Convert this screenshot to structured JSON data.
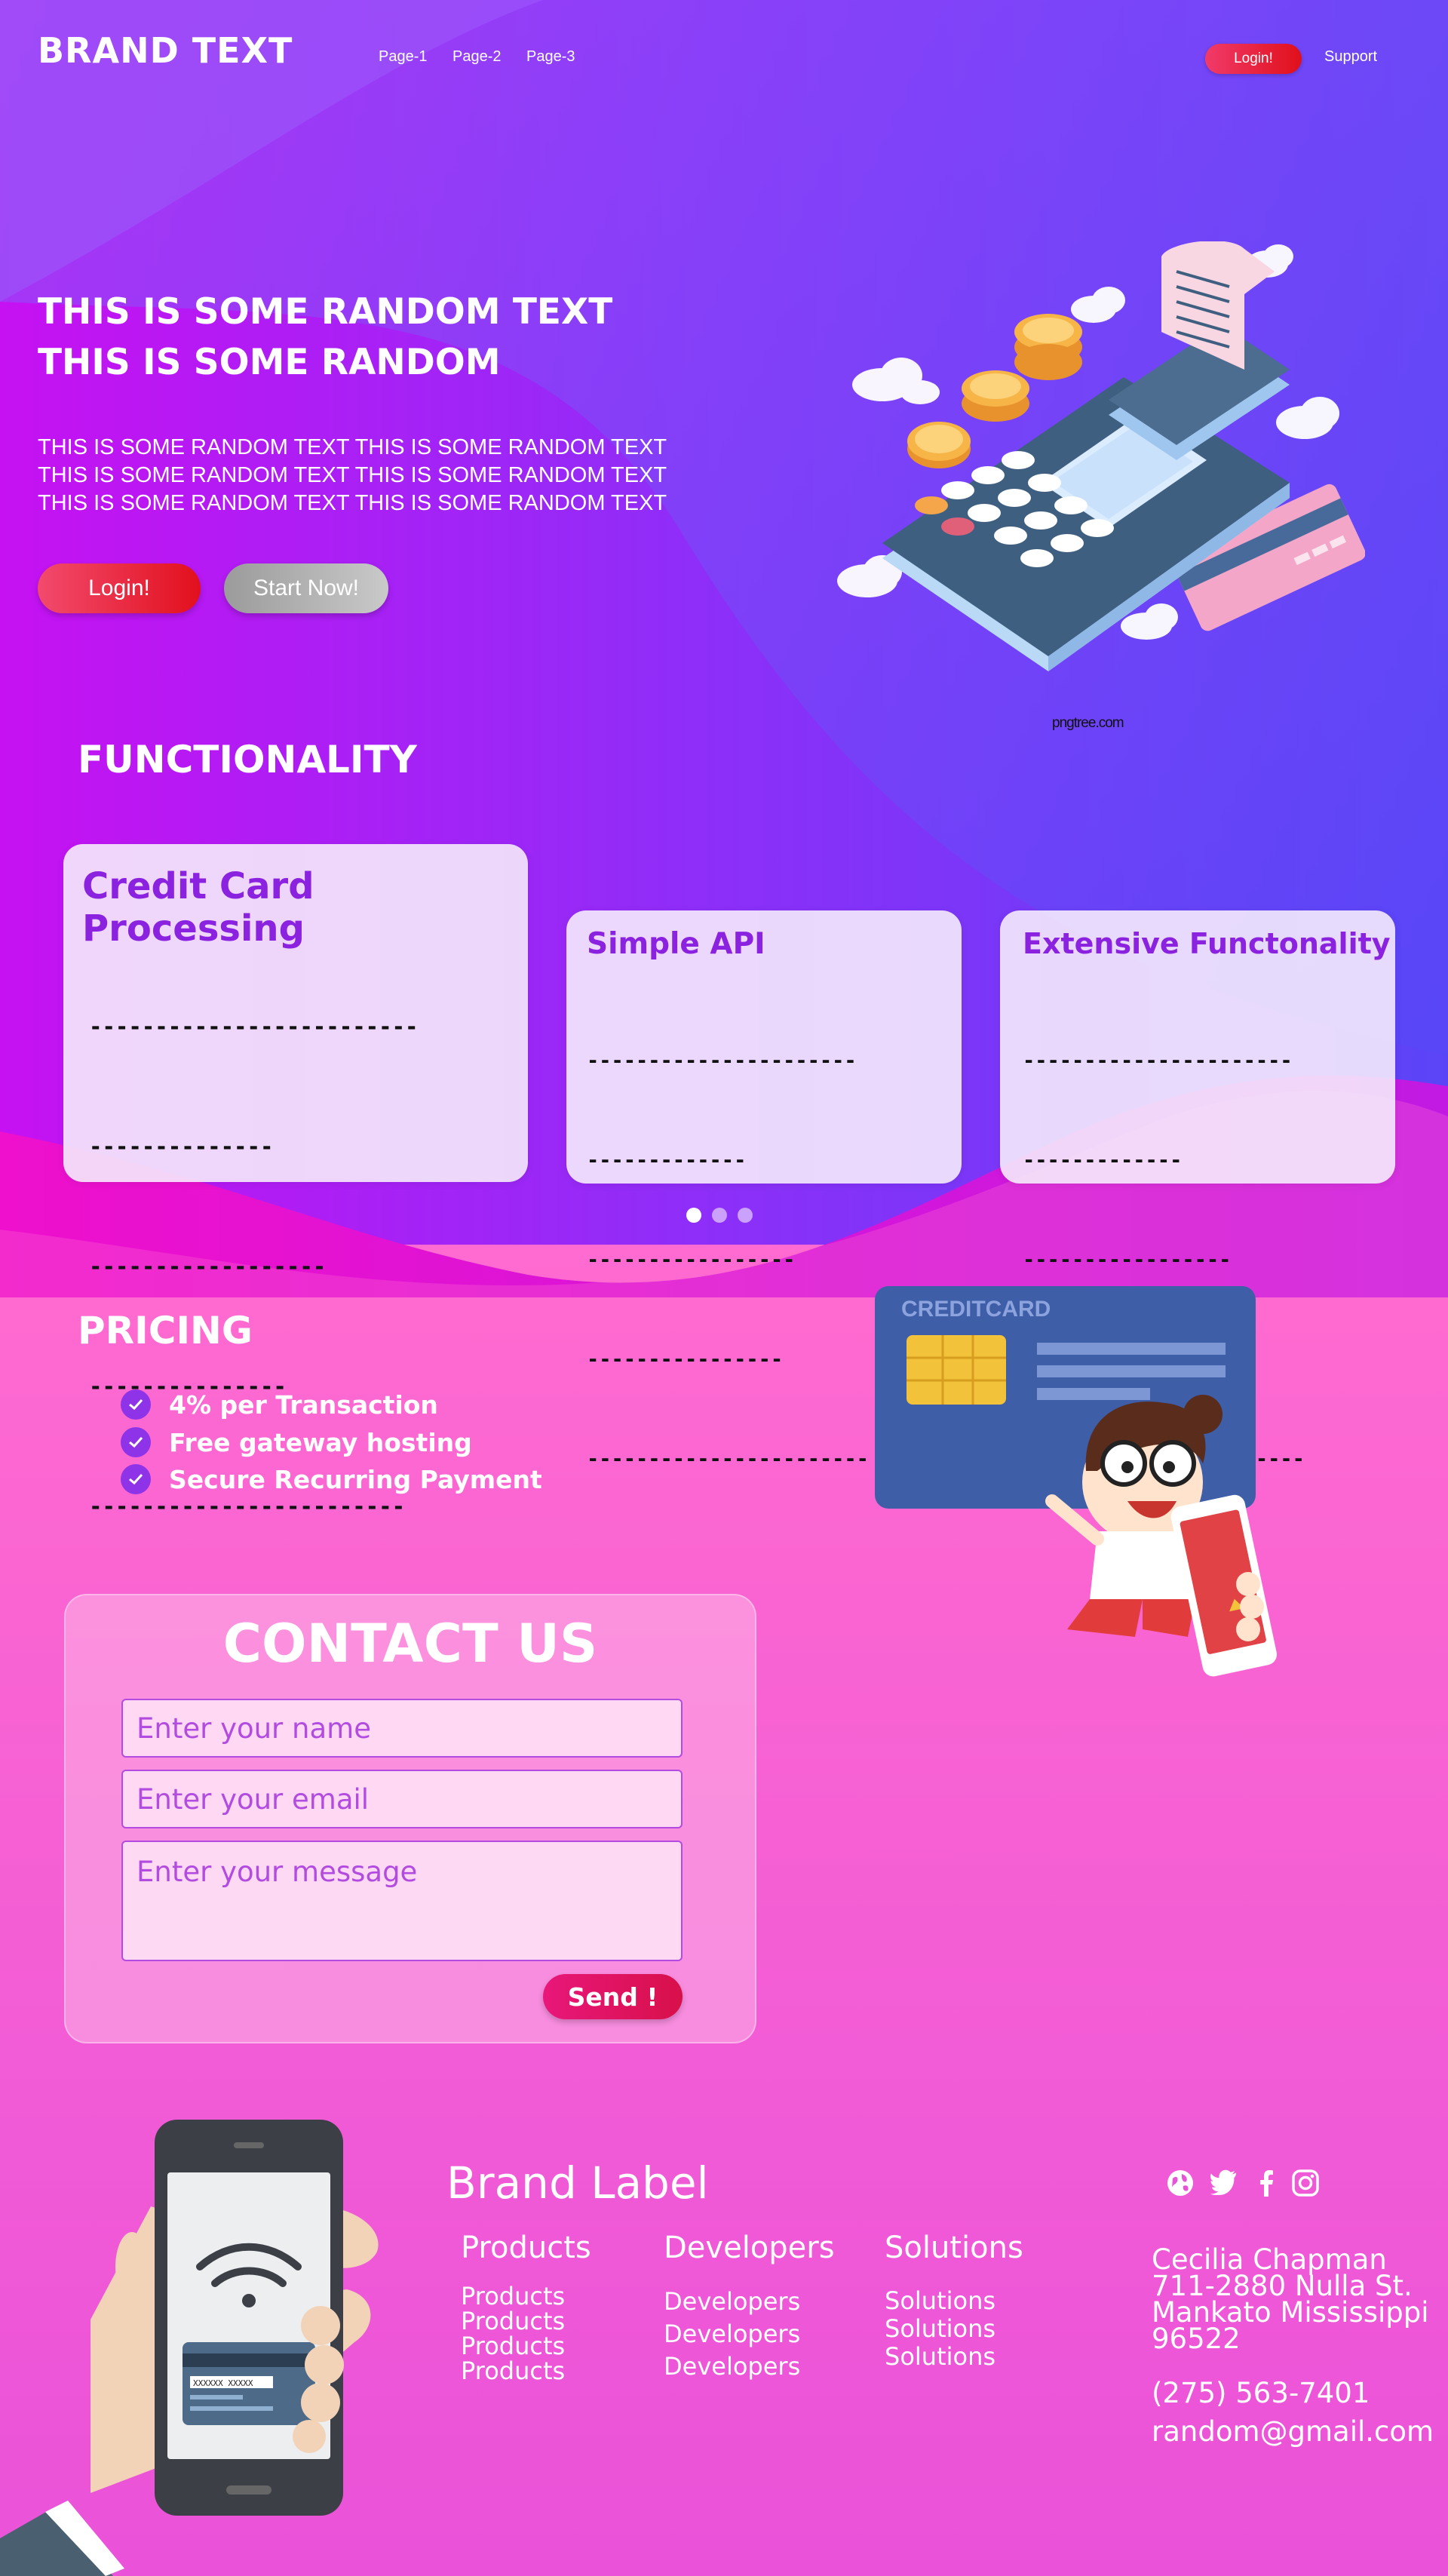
{
  "nav": {
    "brand": "BRAND TEXT",
    "links": [
      "Page-1",
      "Page-2",
      "Page-3"
    ],
    "login": "Login!",
    "support": "Support"
  },
  "hero": {
    "title_line1": "THIS IS SOME RANDOM TEXT",
    "title_line2": "THIS IS SOME RANDOM",
    "text": "THIS IS SOME RANDOM TEXT THIS IS SOME RANDOM TEXT THIS IS SOME RANDOM TEXT THIS IS SOME RANDOM TEXT THIS IS SOME RANDOM TEXT THIS IS SOME RANDOM TEXT",
    "login_button": "Login!",
    "start_button": "Start Now!",
    "image_credit": "pngtree.com"
  },
  "functionality": {
    "title": "FUNCTIONALITY",
    "cards": [
      {
        "title": "Credit Card Processing",
        "lines": [
          "-------------------------",
          "--------------",
          "------------------",
          "---------------",
          "------------------------"
        ]
      },
      {
        "title": "Simple API",
        "lines": [
          "----------------------",
          "-------------",
          "-----------------",
          "----------------",
          "-----------------------"
        ]
      },
      {
        "title": "Extensive Functonality",
        "lines": [
          "----------------------",
          "-------------",
          "-----------------",
          "----------------",
          "-----------------------"
        ]
      }
    ],
    "carousel_active_index": 0
  },
  "pricing": {
    "title": "PRICING",
    "items": [
      "4% per Transaction",
      "Free gateway hosting",
      "Secure Recurring Payment"
    ],
    "card_illustration_text": "CREDITCARD"
  },
  "contact": {
    "title": "CONTACT US",
    "name_placeholder": "Enter your name",
    "email_placeholder": "Enter your email",
    "message_placeholder": "Enter your message",
    "send": "Send !"
  },
  "footer": {
    "brand": "Brand Label",
    "columns": [
      {
        "heading": "Products",
        "items": [
          "Products",
          "Products",
          "Products",
          "Products"
        ]
      },
      {
        "heading": "Developers",
        "items": [
          "Developers",
          "Developers",
          "Developers"
        ]
      },
      {
        "heading": "Solutions",
        "items": [
          "Solutions",
          "Solutions",
          "Solutions"
        ]
      }
    ],
    "address": [
      "Cecilia Chapman",
      "711-2880 Nulla St.",
      "Mankato Mississippi",
      "96522"
    ],
    "phone": "(275) 563-7401",
    "email": "random@gmail.com",
    "social_icons": [
      "globe-icon",
      "twitter-icon",
      "facebook-icon",
      "instagram-icon"
    ],
    "phone_card_text": "XXXXXX XXXXX"
  },
  "colors": {
    "accent_purple": "#8a22e0",
    "login_red": "#e2101d",
    "send_pink": "#e8177a"
  }
}
